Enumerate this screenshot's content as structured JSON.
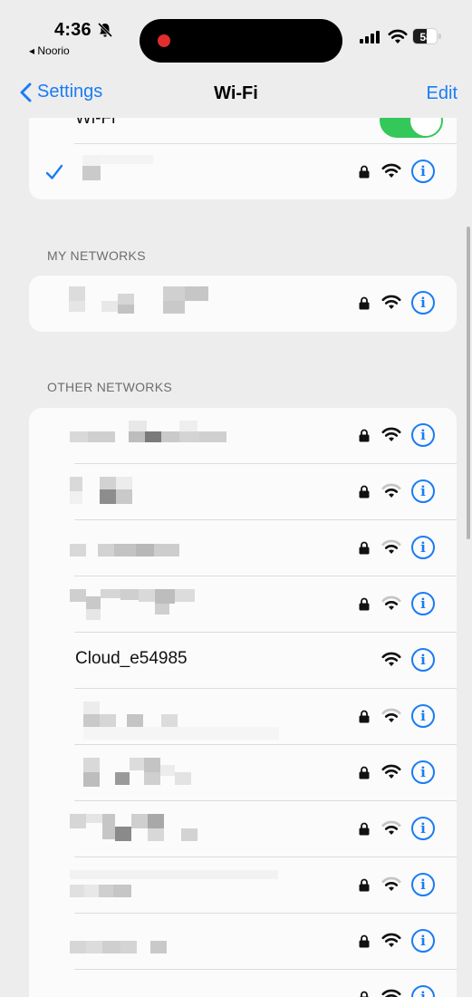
{
  "status_bar": {
    "time": "4:36",
    "back_app": "◂ Noorio",
    "battery": "58",
    "battery_level": 0.58
  },
  "nav": {
    "back_label": "Settings",
    "title": "Wi-Fi",
    "edit_label": "Edit"
  },
  "wifi_row": {
    "label_partial": "Wi-Fi",
    "enabled": true
  },
  "sections": {
    "my_networks": "MY NETWORKS",
    "other_networks": "OTHER NETWORKS"
  },
  "networks": {
    "connected": {
      "name": "",
      "secured": true,
      "signal": 3
    },
    "my": [
      {
        "name": "",
        "secured": true,
        "signal": 3
      }
    ],
    "other": [
      {
        "name": "",
        "secured": true,
        "signal": 3
      },
      {
        "name": "",
        "secured": true,
        "signal": 2
      },
      {
        "name": "",
        "secured": true,
        "signal": 2
      },
      {
        "name": "",
        "secured": true,
        "signal": 2
      },
      {
        "name": "Cloud_e54985",
        "secured": false,
        "signal": 3
      },
      {
        "name": "",
        "secured": true,
        "signal": 2
      },
      {
        "name": "",
        "secured": true,
        "signal": 3
      },
      {
        "name": "",
        "secured": true,
        "signal": 2
      },
      {
        "name": "",
        "secured": true,
        "signal": 2
      },
      {
        "name": "",
        "secured": true,
        "signal": 3
      },
      {
        "name": "",
        "secured": true,
        "signal": 3
      }
    ]
  },
  "icons": {
    "info": "i",
    "lock": "lock-icon",
    "wifi": "wifi-icon",
    "check": "checkmark-icon",
    "back": "chevron-left-icon"
  },
  "colors": {
    "accent": "#1a7cf5",
    "toggle_on": "#34c759",
    "background": "#ededed",
    "card": "#fbfbfb"
  }
}
